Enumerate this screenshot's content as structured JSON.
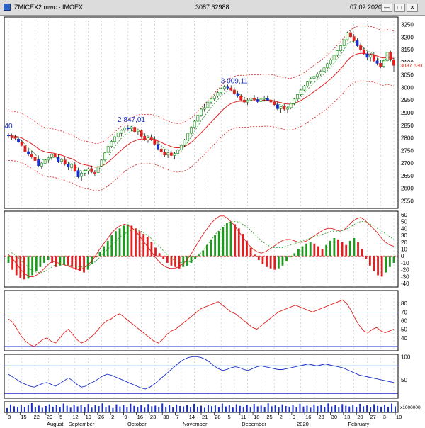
{
  "window": {
    "title": "ZMICEX2.mwc - IMOEX",
    "last_value": "3087.62988",
    "date": "07.02.2020",
    "icons": [
      "app-icon",
      "minimize-icon",
      "maximize-icon",
      "close-icon"
    ]
  },
  "chart_data": [
    {
      "type": "candlestick",
      "instrument": "IMOEX",
      "ylim": [
        2520,
        3280
      ],
      "yticks": [
        2550,
        2600,
        2650,
        2700,
        2750,
        2800,
        2850,
        2900,
        2950,
        3000,
        3050,
        3100,
        3150,
        3200,
        3250
      ],
      "last_price_label": "3087.630",
      "annotations": [
        {
          "text": "40",
          "near_index": 0
        },
        {
          "text": "2 847,01",
          "near_index": 37
        },
        {
          "text": "3 009,11",
          "near_index": 68
        }
      ],
      "ohlc": [
        [
          2811,
          2821,
          2800,
          2809
        ],
        [
          2808,
          2817,
          2792,
          2800
        ],
        [
          2802,
          2812,
          2790,
          2798
        ],
        [
          2795,
          2805,
          2780,
          2785
        ],
        [
          2784,
          2793,
          2766,
          2770
        ],
        [
          2768,
          2778,
          2740,
          2745
        ],
        [
          2745,
          2760,
          2728,
          2735
        ],
        [
          2735,
          2750,
          2718,
          2724
        ],
        [
          2724,
          2740,
          2700,
          2710
        ],
        [
          2713,
          2730,
          2685,
          2690
        ],
        [
          2688,
          2706,
          2676,
          2700
        ],
        [
          2699,
          2716,
          2690,
          2712
        ],
        [
          2712,
          2726,
          2701,
          2720
        ],
        [
          2722,
          2738,
          2712,
          2734
        ],
        [
          2735,
          2746,
          2718,
          2725
        ],
        [
          2722,
          2733,
          2700,
          2705
        ],
        [
          2707,
          2720,
          2694,
          2714
        ],
        [
          2712,
          2726,
          2690,
          2695
        ],
        [
          2694,
          2706,
          2672,
          2685
        ],
        [
          2682,
          2700,
          2670,
          2695
        ],
        [
          2692,
          2704,
          2665,
          2668
        ],
        [
          2670,
          2682,
          2640,
          2645
        ],
        [
          2647,
          2665,
          2630,
          2660
        ],
        [
          2660,
          2674,
          2648,
          2670
        ],
        [
          2668,
          2682,
          2654,
          2676
        ],
        [
          2678,
          2690,
          2660,
          2665
        ],
        [
          2662,
          2672,
          2648,
          2660
        ],
        [
          2662,
          2690,
          2656,
          2686
        ],
        [
          2688,
          2716,
          2684,
          2712
        ],
        [
          2712,
          2744,
          2708,
          2740
        ],
        [
          2742,
          2770,
          2736,
          2766
        ],
        [
          2766,
          2790,
          2760,
          2786
        ],
        [
          2786,
          2808,
          2778,
          2804
        ],
        [
          2804,
          2824,
          2796,
          2820
        ],
        [
          2818,
          2834,
          2806,
          2830
        ],
        [
          2830,
          2846,
          2820,
          2840
        ],
        [
          2840,
          2850,
          2828,
          2836
        ],
        [
          2836,
          2847,
          2826,
          2844
        ],
        [
          2842,
          2846,
          2820,
          2825
        ],
        [
          2825,
          2836,
          2810,
          2830
        ],
        [
          2828,
          2834,
          2800,
          2806
        ],
        [
          2806,
          2818,
          2788,
          2792
        ],
        [
          2792,
          2805,
          2780,
          2800
        ],
        [
          2800,
          2814,
          2788,
          2794
        ],
        [
          2794,
          2806,
          2770,
          2775
        ],
        [
          2774,
          2786,
          2750,
          2756
        ],
        [
          2756,
          2770,
          2738,
          2745
        ],
        [
          2744,
          2756,
          2725,
          2732
        ],
        [
          2732,
          2746,
          2720,
          2740
        ],
        [
          2740,
          2750,
          2724,
          2730
        ],
        [
          2730,
          2744,
          2716,
          2738
        ],
        [
          2738,
          2756,
          2732,
          2752
        ],
        [
          2752,
          2776,
          2746,
          2770
        ],
        [
          2770,
          2796,
          2764,
          2792
        ],
        [
          2792,
          2822,
          2786,
          2818
        ],
        [
          2818,
          2846,
          2812,
          2842
        ],
        [
          2842,
          2870,
          2836,
          2866
        ],
        [
          2866,
          2894,
          2860,
          2890
        ],
        [
          2890,
          2918,
          2884,
          2914
        ],
        [
          2914,
          2934,
          2904,
          2920
        ],
        [
          2920,
          2946,
          2914,
          2942
        ],
        [
          2942,
          2960,
          2934,
          2954
        ],
        [
          2954,
          2972,
          2946,
          2966
        ],
        [
          2966,
          2986,
          2960,
          2980
        ],
        [
          2980,
          3000,
          2972,
          2996
        ],
        [
          2996,
          3010,
          2988,
          3002
        ],
        [
          3002,
          3012,
          2990,
          2998
        ],
        [
          2998,
          3009,
          2984,
          2990
        ],
        [
          2990,
          3000,
          2970,
          2976
        ],
        [
          2976,
          2988,
          2960,
          2966
        ],
        [
          2966,
          2976,
          2946,
          2950
        ],
        [
          2950,
          2962,
          2936,
          2942
        ],
        [
          2942,
          2956,
          2930,
          2950
        ],
        [
          2950,
          2964,
          2940,
          2958
        ],
        [
          2958,
          2970,
          2946,
          2952
        ],
        [
          2952,
          2962,
          2938,
          2944
        ],
        [
          2944,
          2958,
          2934,
          2954
        ],
        [
          2954,
          2966,
          2944,
          2958
        ],
        [
          2958,
          2968,
          2946,
          2950
        ],
        [
          2950,
          2960,
          2936,
          2942
        ],
        [
          2942,
          2952,
          2926,
          2932
        ],
        [
          2932,
          2944,
          2910,
          2916
        ],
        [
          2916,
          2928,
          2900,
          2924
        ],
        [
          2924,
          2934,
          2908,
          2914
        ],
        [
          2914,
          2926,
          2898,
          2920
        ],
        [
          2920,
          2940,
          2914,
          2936
        ],
        [
          2936,
          2958,
          2930,
          2954
        ],
        [
          2954,
          2976,
          2948,
          2972
        ],
        [
          2972,
          2994,
          2966,
          2990
        ],
        [
          2990,
          3010,
          2984,
          3006
        ],
        [
          3006,
          3026,
          3000,
          3022
        ],
        [
          3022,
          3040,
          3016,
          3036
        ],
        [
          3036,
          3050,
          3026,
          3044
        ],
        [
          3044,
          3060,
          3036,
          3054
        ],
        [
          3054,
          3070,
          3046,
          3064
        ],
        [
          3064,
          3082,
          3058,
          3078
        ],
        [
          3078,
          3098,
          3072,
          3094
        ],
        [
          3094,
          3116,
          3088,
          3110
        ],
        [
          3110,
          3132,
          3104,
          3128
        ],
        [
          3128,
          3150,
          3122,
          3146
        ],
        [
          3146,
          3170,
          3140,
          3166
        ],
        [
          3166,
          3194,
          3160,
          3190
        ],
        [
          3190,
          3222,
          3186,
          3218
        ],
        [
          3218,
          3226,
          3196,
          3202
        ],
        [
          3202,
          3212,
          3180,
          3186
        ],
        [
          3186,
          3196,
          3160,
          3166
        ],
        [
          3166,
          3180,
          3144,
          3150
        ],
        [
          3150,
          3160,
          3128,
          3134
        ],
        [
          3134,
          3144,
          3110,
          3120
        ],
        [
          3120,
          3136,
          3104,
          3130
        ],
        [
          3130,
          3142,
          3100,
          3106
        ],
        [
          3106,
          3118,
          3088,
          3096
        ],
        [
          3096,
          3108,
          3076,
          3084
        ],
        [
          3084,
          3112,
          3078,
          3106
        ],
        [
          3106,
          3148,
          3100,
          3140
        ],
        [
          3140,
          3146,
          3104,
          3110
        ],
        [
          3110,
          3118,
          3062,
          3088
        ]
      ]
    },
    {
      "type": "histogram_with_lines",
      "name": "oscillator",
      "ylim": [
        -45,
        65
      ],
      "yticks": [
        -40,
        -30,
        -20,
        -10,
        0,
        10,
        20,
        30,
        40,
        50,
        60
      ],
      "hist": [
        -10,
        -20,
        -28,
        -32,
        -34,
        -33,
        -28,
        -22,
        -16,
        -10,
        -6,
        -10,
        -16,
        -14,
        -12,
        -14,
        -16,
        -20,
        -22,
        -24,
        -20,
        -12,
        -2,
        6,
        14,
        22,
        30,
        36,
        40,
        44,
        46,
        44,
        40,
        36,
        32,
        28,
        20,
        12,
        4,
        -4,
        -10,
        -14,
        -16,
        -18,
        -16,
        -14,
        -10,
        -4,
        2,
        8,
        16,
        24,
        30,
        36,
        42,
        48,
        50,
        46,
        40,
        32,
        22,
        12,
        2,
        -6,
        -12,
        -16,
        -18,
        -20,
        -18,
        -14,
        -8,
        -2,
        4,
        10,
        14,
        18,
        20,
        18,
        14,
        10,
        16,
        22,
        26,
        24,
        20,
        16,
        22,
        26,
        20,
        10,
        -4,
        -14,
        -22,
        -28,
        -30,
        -24,
        -16,
        -10
      ],
      "line1": [
        2,
        -4,
        -12,
        -20,
        -26,
        -30,
        -30,
        -27,
        -22,
        -16,
        -10,
        -8,
        -10,
        -12,
        -14,
        -16,
        -18,
        -20,
        -18,
        -14,
        -8,
        0,
        10,
        18,
        26,
        34,
        40,
        44,
        46,
        44,
        40,
        34,
        26,
        18,
        10,
        2,
        -6,
        -12,
        -16,
        -18,
        -18,
        -16,
        -12,
        -6,
        2,
        12,
        22,
        32,
        40,
        48,
        54,
        58,
        58,
        54,
        48,
        40,
        32,
        24,
        16,
        10,
        6,
        4,
        6,
        10,
        14,
        18,
        22,
        24,
        24,
        22,
        20,
        20,
        22,
        26,
        30,
        34,
        38,
        40,
        40,
        38,
        36,
        38,
        44,
        50,
        54,
        56,
        52,
        46,
        40,
        34,
        26,
        20,
        16,
        14
      ],
      "line2": [
        6,
        4,
        0,
        -6,
        -12,
        -18,
        -22,
        -24,
        -24,
        -22,
        -18,
        -14,
        -12,
        -12,
        -13,
        -14,
        -15,
        -16,
        -16,
        -15,
        -12,
        -8,
        -2,
        4,
        10,
        16,
        22,
        28,
        32,
        36,
        38,
        38,
        36,
        32,
        28,
        22,
        16,
        10,
        4,
        -2,
        -6,
        -9,
        -10,
        -10,
        -8,
        -4,
        2,
        8,
        16,
        24,
        32,
        38,
        44,
        48,
        50,
        50,
        48,
        44,
        40,
        34,
        28,
        22,
        18,
        14,
        12,
        12,
        12,
        14,
        16,
        18,
        20,
        22,
        24,
        26,
        28,
        30,
        32,
        34,
        36,
        36,
        36,
        38,
        40,
        44,
        48,
        50,
        50,
        48,
        44,
        40,
        36,
        32,
        28,
        24
      ],
      "hist_up_color": "#1e9b1e",
      "hist_down_color": "#e02020"
    },
    {
      "type": "line",
      "name": "oscillator-1",
      "ylim": [
        25,
        95
      ],
      "yticks": [
        40,
        50,
        60,
        70,
        80
      ],
      "levels": [
        30,
        70
      ],
      "color": "#e02020",
      "values": [
        62,
        58,
        50,
        42,
        36,
        32,
        30,
        34,
        38,
        40,
        36,
        34,
        40,
        46,
        50,
        44,
        38,
        34,
        36,
        40,
        44,
        50,
        56,
        60,
        62,
        66,
        68,
        64,
        60,
        56,
        52,
        48,
        44,
        40,
        36,
        34,
        38,
        44,
        48,
        50,
        54,
        58,
        62,
        66,
        70,
        74,
        76,
        78,
        80,
        82,
        78,
        74,
        70,
        68,
        64,
        60,
        56,
        52,
        50,
        54,
        58,
        62,
        66,
        70,
        72,
        74,
        76,
        78,
        76,
        74,
        72,
        70,
        72,
        74,
        76,
        78,
        80,
        82,
        84,
        80,
        72,
        62,
        54,
        48,
        46,
        50,
        52,
        48,
        46,
        48,
        50
      ]
    },
    {
      "type": "line",
      "name": "oscillator-2",
      "ylim": [
        10,
        105
      ],
      "yticks": [
        50,
        100
      ],
      "levels": [
        20,
        80
      ],
      "color": "#1a2ec8",
      "values": [
        62,
        56,
        50,
        44,
        40,
        36,
        34,
        38,
        42,
        44,
        40,
        36,
        42,
        48,
        54,
        48,
        40,
        34,
        36,
        42,
        46,
        52,
        58,
        62,
        60,
        56,
        52,
        48,
        44,
        40,
        36,
        32,
        30,
        34,
        40,
        48,
        56,
        64,
        72,
        80,
        88,
        94,
        98,
        100,
        100,
        98,
        94,
        88,
        80,
        74,
        70,
        72,
        76,
        78,
        76,
        72,
        70,
        74,
        78,
        80,
        78,
        76,
        74,
        72,
        72,
        74,
        76,
        78,
        80,
        82,
        84,
        82,
        80,
        82,
        84,
        82,
        80,
        78,
        76,
        72,
        68,
        64,
        60,
        58,
        56,
        54,
        52,
        50,
        48,
        46,
        44
      ]
    },
    {
      "type": "bar",
      "name": "volume",
      "unit_label": "x1000000",
      "values": [
        34,
        62,
        48,
        41,
        55,
        39,
        60,
        72,
        44,
        53,
        36,
        50,
        64,
        45,
        58,
        40,
        69,
        52,
        37,
        61,
        47,
        56,
        43,
        66,
        38,
        58,
        49,
        71,
        42,
        54,
        35,
        63,
        46,
        57,
        40,
        68,
        51,
        44,
        59,
        37,
        65,
        48,
        53,
        42,
        70,
        45,
        56,
        39,
        62,
        50,
        47,
        58,
        41,
        67,
        44,
        52,
        36,
        61,
        49,
        55,
        43,
        69,
        46,
        57,
        38,
        64,
        51,
        45,
        60,
        40,
        66,
        47,
        54,
        42,
        71,
        48,
        57,
        39,
        63,
        50,
        45,
        59,
        41,
        68,
        46,
        53,
        37,
        62,
        49,
        56,
        44,
        70,
        47,
        58,
        40,
        65,
        52,
        46,
        61,
        43,
        67,
        48,
        55,
        39,
        64,
        51,
        45,
        60,
        42,
        69,
        47
      ]
    }
  ],
  "x_axis": {
    "day_ticks": [
      "8",
      "15",
      "22",
      "29",
      "5",
      "12",
      "19",
      "26",
      "2",
      "9",
      "16",
      "23",
      "30",
      "7",
      "14",
      "21",
      "28",
      "5",
      "11",
      "18",
      "25",
      "2",
      "9",
      "16",
      "23",
      "30",
      "13",
      "20",
      "27",
      "3",
      "10"
    ],
    "month_labels": [
      "August",
      "September",
      "October",
      "November",
      "December",
      "2020",
      "February"
    ]
  }
}
